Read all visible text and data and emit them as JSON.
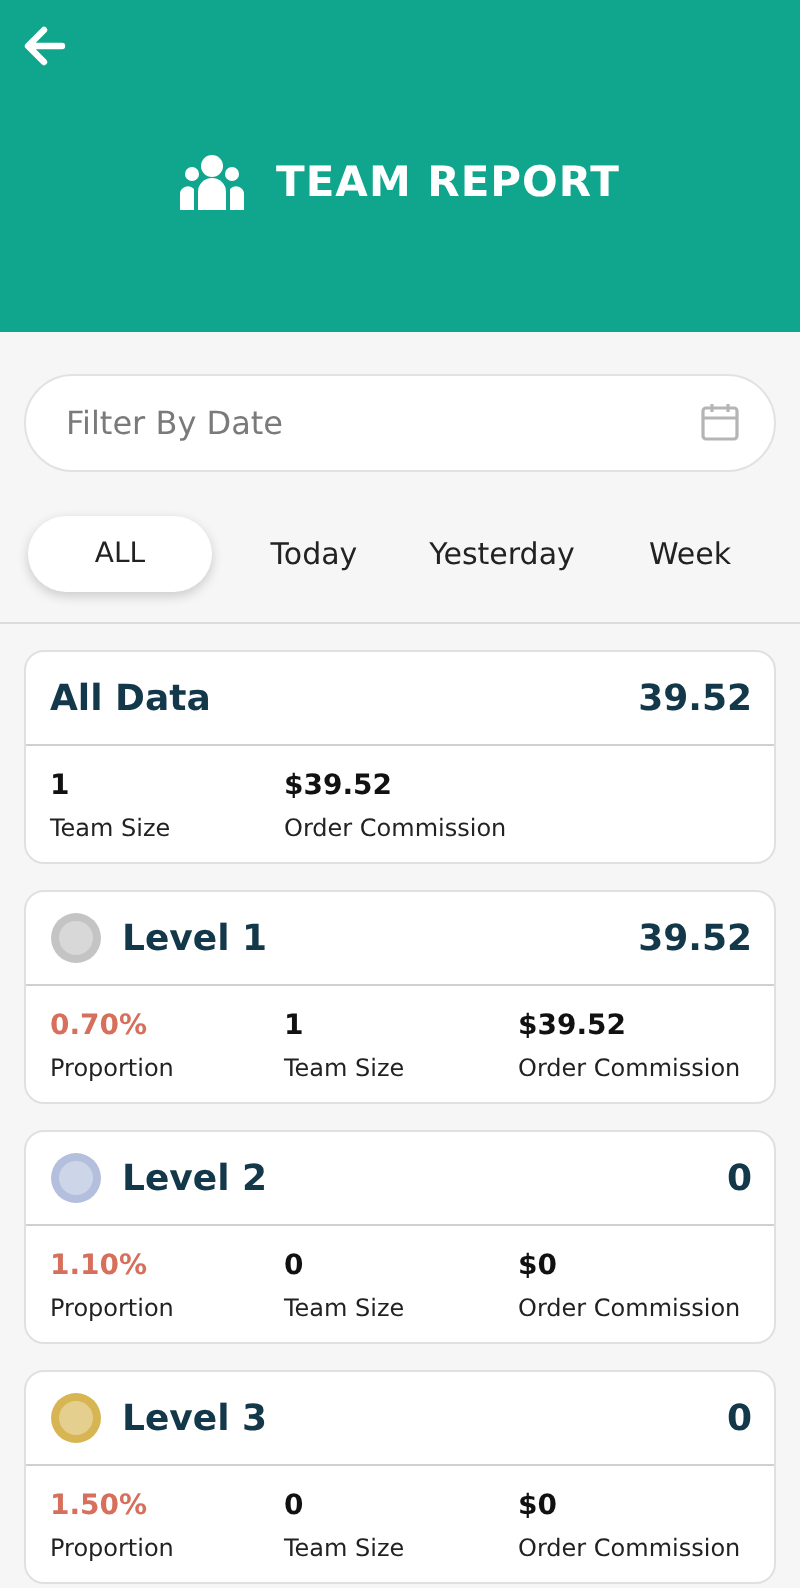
{
  "header": {
    "title": "TEAM REPORT"
  },
  "filter": {
    "placeholder": "Filter By Date"
  },
  "tabs": [
    {
      "label": "ALL",
      "selected": true
    },
    {
      "label": "Today",
      "selected": false
    },
    {
      "label": "Yesterday",
      "selected": false
    },
    {
      "label": "Week",
      "selected": false
    }
  ],
  "cards": [
    {
      "kind": "summary",
      "title": "All Data",
      "total": "39.52",
      "stats": [
        {
          "kind": "count",
          "value": "1",
          "label": "Team Size"
        },
        {
          "kind": "money",
          "value": "$39.52",
          "label": "Order Commission"
        }
      ]
    },
    {
      "kind": "level",
      "title": "Level 1",
      "total": "39.52",
      "color": "#c4c4c4",
      "stats": [
        {
          "kind": "percent",
          "value": "0.70%",
          "label": "Proportion"
        },
        {
          "kind": "count",
          "value": "1",
          "label": "Team Size"
        },
        {
          "kind": "money",
          "value": "$39.52",
          "label": "Order Commission"
        }
      ]
    },
    {
      "kind": "level",
      "title": "Level 2",
      "total": "0",
      "color": "#b3bfdc",
      "stats": [
        {
          "kind": "percent",
          "value": "1.10%",
          "label": "Proportion"
        },
        {
          "kind": "count",
          "value": "0",
          "label": "Team Size"
        },
        {
          "kind": "money",
          "value": "$0",
          "label": "Order Commission"
        }
      ]
    },
    {
      "kind": "level",
      "title": "Level 3",
      "total": "0",
      "color": "#d6b552",
      "stats": [
        {
          "kind": "percent",
          "value": "1.50%",
          "label": "Proportion"
        },
        {
          "kind": "count",
          "value": "0",
          "label": "Team Size"
        },
        {
          "kind": "money",
          "value": "$0",
          "label": "Order Commission"
        }
      ]
    }
  ]
}
